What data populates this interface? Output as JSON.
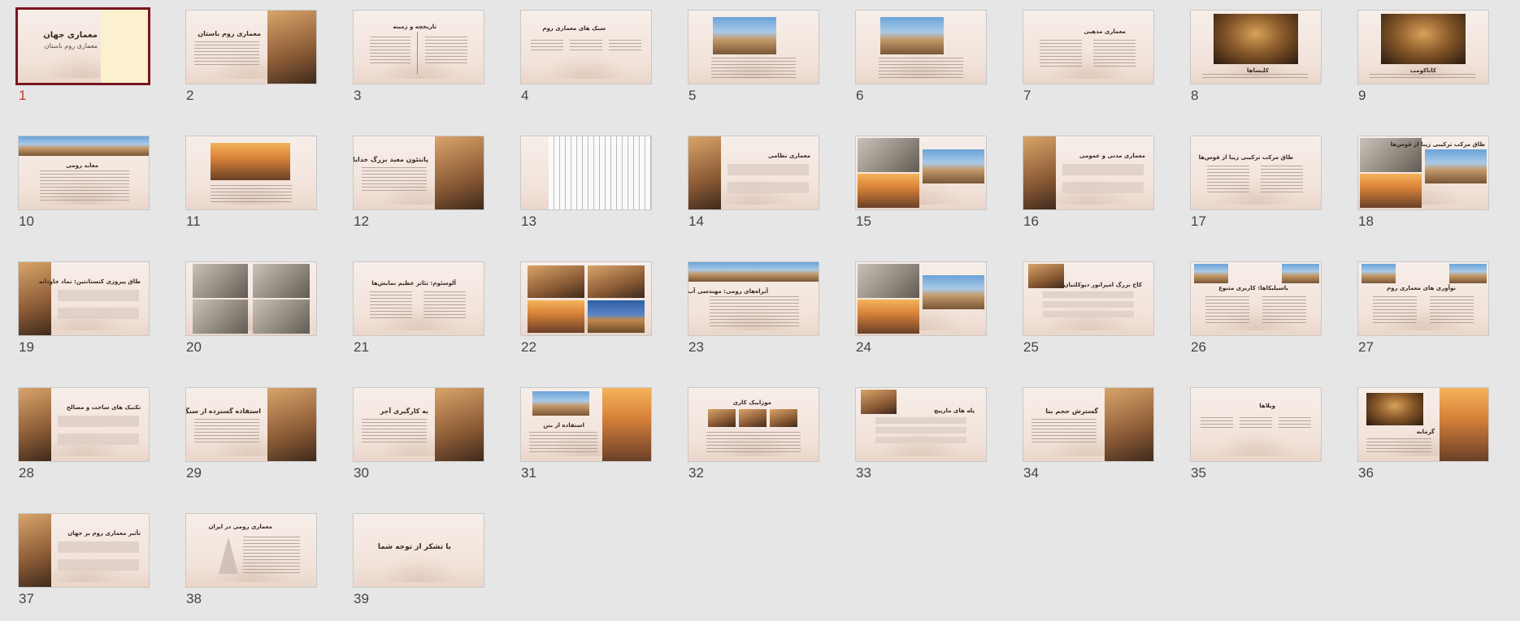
{
  "view": "slide-sorter",
  "selected_slide": 1,
  "slides": [
    {
      "n": "1",
      "title": "معماری جهان",
      "subtitle": "معماری روم باستان",
      "layout": "title-cream"
    },
    {
      "n": "2",
      "title": "معماری روم باستان",
      "layout": "text-right-photo"
    },
    {
      "n": "3",
      "title": "تاریخچه و زمینه",
      "layout": "timeline"
    },
    {
      "n": "4",
      "title": "سبک های معماری روم",
      "layout": "three-cols"
    },
    {
      "n": "5",
      "title": "",
      "layout": "photo-top-text"
    },
    {
      "n": "6",
      "title": "",
      "layout": "photo-top-text"
    },
    {
      "n": "7",
      "title": "معماری مذهبی",
      "layout": "two-cols"
    },
    {
      "n": "8",
      "title": "کلیساها",
      "layout": "photo-center"
    },
    {
      "n": "9",
      "title": "کاتاکومب",
      "layout": "photo-center"
    },
    {
      "n": "10",
      "title": "معابد رومی",
      "layout": "photo-banner"
    },
    {
      "n": "11",
      "title": "",
      "layout": "photo-center-text"
    },
    {
      "n": "12",
      "title": "پانتئون معبد بزرگ خدایان",
      "layout": "text-right-photo"
    },
    {
      "n": "13",
      "title": "",
      "layout": "diagram"
    },
    {
      "n": "14",
      "title": "معماری نظامی",
      "layout": "left-photo-text"
    },
    {
      "n": "15",
      "title": "",
      "layout": "photo-grid"
    },
    {
      "n": "16",
      "title": "معماری مدنی و عمومی",
      "layout": "left-photo-text"
    },
    {
      "n": "17",
      "title": "طاق مرکب ترکیبی زیبا از قوس‌ها",
      "layout": "two-cols"
    },
    {
      "n": "18",
      "title": "طاق مرکب ترکیبی زیبا از قوس‌ها",
      "layout": "photo-grid"
    },
    {
      "n": "19",
      "title": "طاق پیروزی کنستانتین: نماد جاودانه",
      "layout": "left-photo-text"
    },
    {
      "n": "20",
      "title": "",
      "layout": "relief-grid"
    },
    {
      "n": "21",
      "title": "آلوسئوم: تئاتر عظیم نمایش‌ها",
      "layout": "two-cols"
    },
    {
      "n": "22",
      "title": "",
      "layout": "photo-grid4"
    },
    {
      "n": "23",
      "title": "آبراه‌های رومی: مهندسی آب برتر",
      "layout": "photo-banner"
    },
    {
      "n": "24",
      "title": "",
      "layout": "photo-grid"
    },
    {
      "n": "25",
      "title": "کاخ بزرگ امپراتور دیوکلتیان",
      "layout": "photo-corner-list"
    },
    {
      "n": "26",
      "title": "باسیلیکاها: کاربری متنوع",
      "layout": "two-photo-cols"
    },
    {
      "n": "27",
      "title": "نوآوری های معماری روم",
      "layout": "two-photo-cols"
    },
    {
      "n": "28",
      "title": "تکنیک های ساخت و مصالح",
      "layout": "left-photo-text"
    },
    {
      "n": "29",
      "title": "استفاده گسترده از سنگ",
      "layout": "text-right-photo"
    },
    {
      "n": "30",
      "title": "به کارگیری آجر",
      "layout": "text-right-photo"
    },
    {
      "n": "31",
      "title": "استفاده از بتن",
      "layout": "photo-split"
    },
    {
      "n": "32",
      "title": "موزاییک کاری",
      "layout": "photo-strip"
    },
    {
      "n": "33",
      "title": "پله های مارپیچ",
      "layout": "photo-corner-list"
    },
    {
      "n": "34",
      "title": "گسترش حجم بنا",
      "layout": "text-right-photo"
    },
    {
      "n": "35",
      "title": "ویلاها",
      "layout": "three-cols"
    },
    {
      "n": "36",
      "title": "گرمابه",
      "layout": "photo-left-right"
    },
    {
      "n": "37",
      "title": "تأثیر معماری روم بر جهان",
      "layout": "left-photo-text"
    },
    {
      "n": "38",
      "title": "معماری رومی در ایران",
      "layout": "pyramid"
    },
    {
      "n": "39",
      "title": "با تشکر از توجه شما",
      "layout": "closing"
    }
  ]
}
